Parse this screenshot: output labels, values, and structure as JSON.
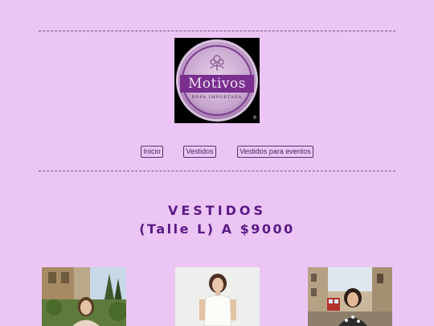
{
  "brand": {
    "name": "Motivos",
    "tagline": "ROPA IMPORTADA"
  },
  "nav": {
    "items": [
      {
        "label": "Inicio"
      },
      {
        "label": "Vestidos"
      },
      {
        "label": "Vestidos para eventos"
      }
    ]
  },
  "section": {
    "title_line1": "VESTIDOS",
    "title_line2": "(Talle L) A $9000"
  },
  "products": [
    {
      "image": "woman-in-garden-photo"
    },
    {
      "image": "woman-white-dress-photo"
    },
    {
      "image": "woman-city-street-photo"
    }
  ],
  "colors": {
    "background": "#ebc6f5",
    "accent": "#5c1a86",
    "logo_band": "#7a2f8e"
  }
}
